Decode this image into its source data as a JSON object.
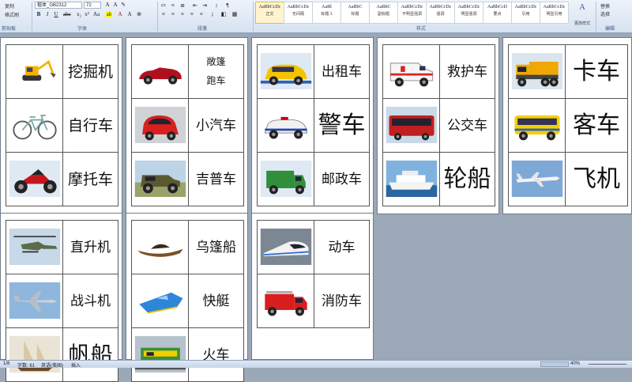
{
  "ribbon": {
    "clipboard": {
      "copy": "复制",
      "format_painter": "格式刷",
      "group": "剪贴板"
    },
    "font": {
      "name": "楷体_GB2312",
      "size": "72",
      "group": "字体"
    },
    "paragraph": {
      "group": "段落"
    },
    "styles": {
      "group": "样式",
      "tiles": [
        {
          "sample": "AaBbCcDc",
          "name": "正文"
        },
        {
          "sample": "AaBbCcDc",
          "name": "无间隔"
        },
        {
          "sample": "AaBl",
          "name": "标题 1"
        },
        {
          "sample": "AaBbC",
          "name": "标题"
        },
        {
          "sample": "AaBbC",
          "name": "副标题"
        },
        {
          "sample": "AaBbCcDc",
          "name": "不明显强调"
        },
        {
          "sample": "AaBbCcDc",
          "name": "强调"
        },
        {
          "sample": "AaBbCcDc",
          "name": "明显强调"
        },
        {
          "sample": "AaBbCcD",
          "name": "要点"
        },
        {
          "sample": "AaBbCcDc",
          "name": "引用"
        },
        {
          "sample": "AaBbCcDc",
          "name": "明显引用"
        }
      ],
      "change_styles": "更改样式"
    },
    "editing": {
      "group": "编辑",
      "replace": "替换",
      "select": "选择"
    }
  },
  "pages": [
    {
      "cards": [
        {
          "label": "挖掘机",
          "icon": "excavator-image"
        },
        {
          "label": "自行车",
          "icon": "bicycle-image"
        },
        {
          "label": "摩托车",
          "icon": "motorcycle-image"
        }
      ]
    },
    {
      "cards": [
        {
          "label": "敞篷",
          "label2": "跑车",
          "icon": "convertible-image"
        },
        {
          "label": "小汽车",
          "icon": "small-car-image"
        },
        {
          "label": "吉普车",
          "icon": "jeep-image"
        }
      ]
    },
    {
      "cards": [
        {
          "label": "出租车",
          "icon": "taxi-image"
        },
        {
          "label": "警车",
          "icon": "police-car-image"
        },
        {
          "label": "邮政车",
          "icon": "postal-truck-image"
        }
      ]
    },
    {
      "cards": [
        {
          "label": "救护车",
          "icon": "ambulance-image"
        },
        {
          "label": "公交车",
          "icon": "bus-image"
        },
        {
          "label": "轮船",
          "icon": "ship-image"
        }
      ]
    },
    {
      "cards": [
        {
          "label": "卡车",
          "icon": "truck-image"
        },
        {
          "label": "客车",
          "icon": "coach-image"
        },
        {
          "label": "飞机",
          "icon": "airplane-image"
        }
      ]
    },
    {
      "cards": [
        {
          "label": "直升机",
          "icon": "helicopter-image"
        },
        {
          "label": "战斗机",
          "icon": "fighter-jet-image"
        },
        {
          "label": "帆船",
          "icon": "sailboat-image"
        }
      ]
    },
    {
      "cards": [
        {
          "label": "乌篷船",
          "icon": "wupeng-boat-image"
        },
        {
          "label": "快艇",
          "icon": "speedboat-image"
        },
        {
          "label": "火车",
          "icon": "train-image"
        }
      ]
    },
    {
      "cards": [
        {
          "label": "动车",
          "icon": "bullet-train-image"
        },
        {
          "label": "消防车",
          "icon": "fire-truck-image"
        }
      ]
    }
  ],
  "status": {
    "page": "1/8",
    "words": "字数: 61",
    "language": "英语(美国)",
    "mode": "插入",
    "zoom": "40%"
  }
}
